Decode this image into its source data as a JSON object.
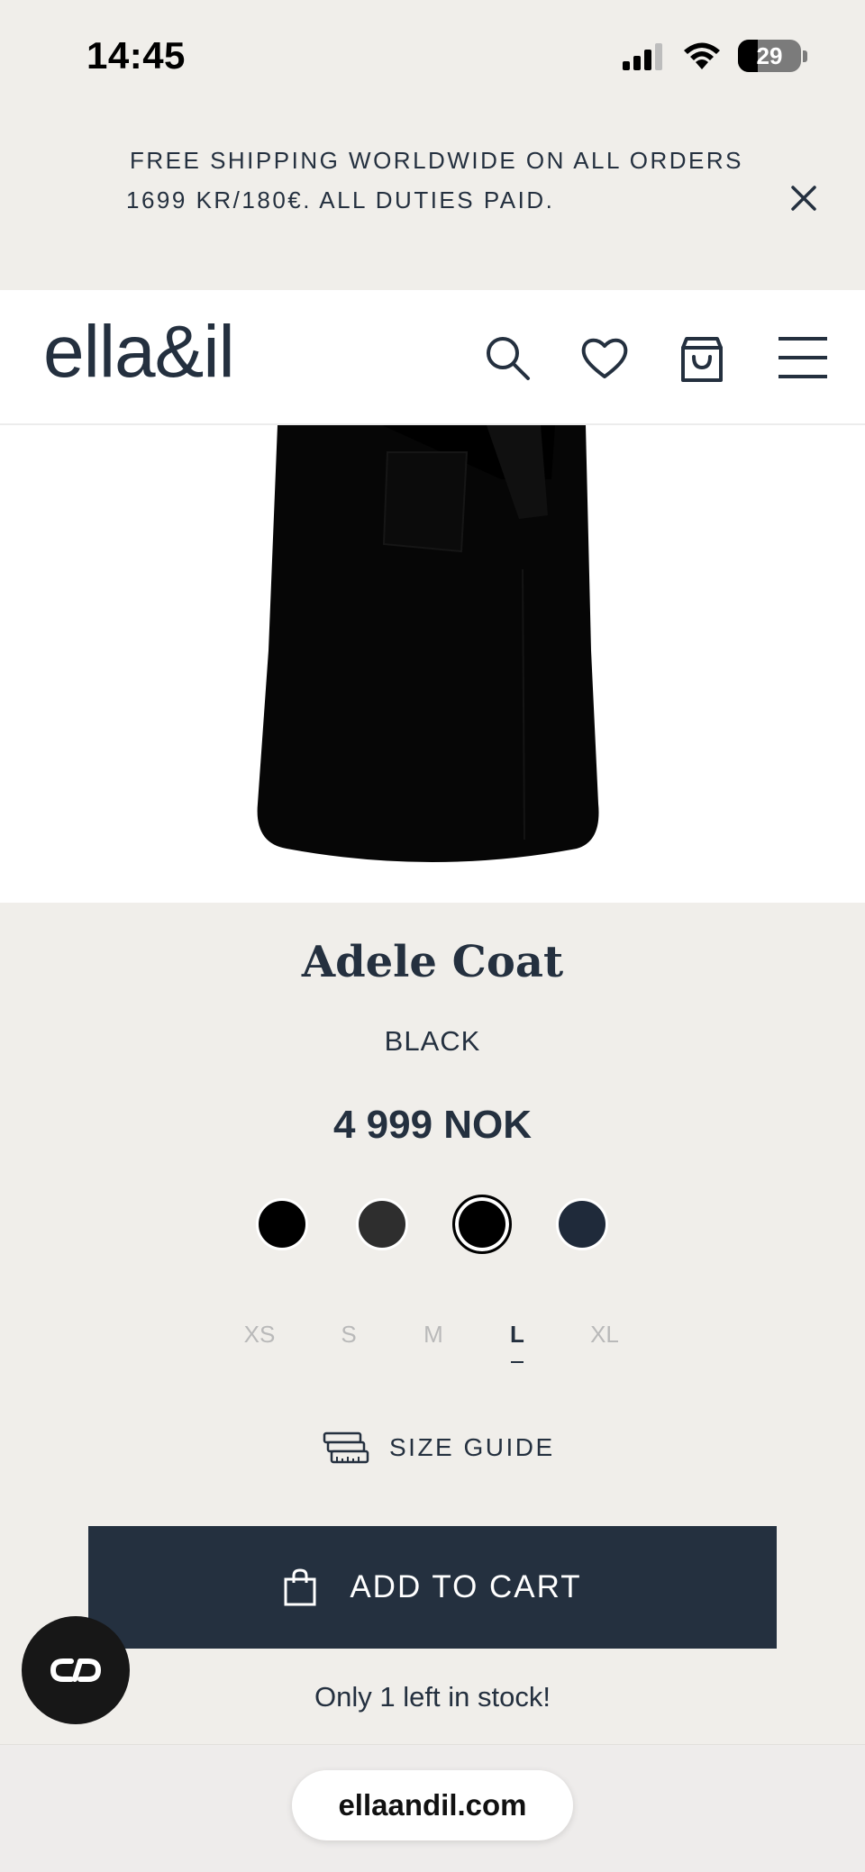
{
  "status_bar": {
    "time": "14:45",
    "battery": "29"
  },
  "promo": {
    "line1": "FREE SHIPPING WORLDWIDE ON ALL ORDERS",
    "line2": "1699 KR/180€.  ALL DUTIES PAID."
  },
  "header": {
    "logo": "ella&il"
  },
  "product": {
    "title": "Adele Coat",
    "color": "BLACK",
    "price": "4 999 NOK",
    "swatches": [
      "#000000",
      "#2e2e2e",
      "#000000",
      "#1f2a3a"
    ],
    "selected_swatch": 2,
    "sizes": [
      "XS",
      "S",
      "M",
      "L",
      "XL"
    ],
    "selected_size": "L"
  },
  "size_guide": {
    "label": "SIZE GUIDE"
  },
  "cart": {
    "add_label": "ADD TO CART",
    "stock_note": "Only 1 left in stock!"
  },
  "browser": {
    "url": "ellaandil.com"
  },
  "colors": {
    "navy": "#24303f",
    "background": "#f0eeea",
    "muted": "#b9b9b9"
  }
}
